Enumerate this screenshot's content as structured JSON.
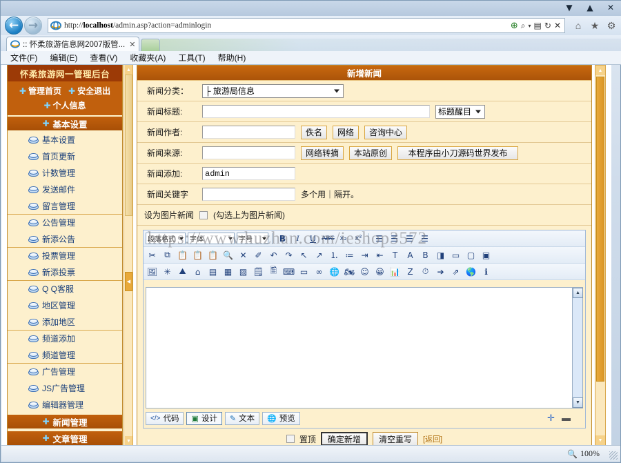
{
  "window": {
    "controls": {
      "minimize": "▼",
      "maximize": "▲",
      "close": "✕"
    }
  },
  "browser": {
    "back_icon": "←",
    "forward_icon": "→",
    "url_prefix": "http://",
    "url_host": "localhost",
    "url_rest": "/admin.asp?action=adminlogin",
    "address_icons": {
      "compatibility": "⊕",
      "search": "⌕",
      "search_caret": "▾",
      "feed": "▤",
      "refresh": "↻",
      "stop": "✕"
    },
    "toolbar_icons": {
      "home": "⌂",
      "favorites": "★",
      "tools": "⚙"
    },
    "tab": {
      "title": ":: 怀柔旅游信息网2007版管...",
      "close": "✕"
    },
    "menu": [
      {
        "label": "文件(F)",
        "key": "F"
      },
      {
        "label": "编辑(E)",
        "key": "E"
      },
      {
        "label": "查看(V)",
        "key": "V"
      },
      {
        "label": "收藏夹(A)",
        "key": "A"
      },
      {
        "label": "工具(T)",
        "key": "T"
      },
      {
        "label": "帮助(H)",
        "key": "H"
      }
    ],
    "status": {
      "zoom": "100%",
      "mag_icon": "🔍"
    }
  },
  "sidebar": {
    "title": "怀柔旅游网一管理后台",
    "top_links": [
      {
        "label": "管理首页"
      },
      {
        "label": "安全退出"
      },
      {
        "label": "个人信息"
      }
    ],
    "group_basic": "基本设置",
    "items": [
      {
        "label": "基本设置",
        "sep": false
      },
      {
        "label": "首页更新",
        "sep": false
      },
      {
        "label": "计数管理",
        "sep": false
      },
      {
        "label": "发送邮件",
        "sep": false
      },
      {
        "label": "留言管理",
        "sep": false
      },
      {
        "label": "公告管理",
        "sep": true
      },
      {
        "label": "新添公告",
        "sep": false
      },
      {
        "label": "投票管理",
        "sep": true
      },
      {
        "label": "新添投票",
        "sep": false
      },
      {
        "label": "Q Q客服",
        "sep": true
      },
      {
        "label": "地区管理",
        "sep": false
      },
      {
        "label": "添加地区",
        "sep": false
      },
      {
        "label": "频道添加",
        "sep": true
      },
      {
        "label": "频道管理",
        "sep": false
      },
      {
        "label": "广告管理",
        "sep": true
      },
      {
        "label": "JS广告管理",
        "sep": false
      },
      {
        "label": "编辑器管理",
        "sep": false
      }
    ],
    "group_news": "新闻管理",
    "group_article": "文章管理"
  },
  "main": {
    "title": "新增新闻",
    "rows": {
      "category": {
        "label": "新闻分类：",
        "value": "├ 旅游局信息"
      },
      "title": {
        "label": "新闻标题:",
        "value": "",
        "highlight_select": "标题醒目"
      },
      "author": {
        "label": "新闻作者:",
        "value": "",
        "buttons": [
          "佚名",
          "网络",
          "咨询中心"
        ]
      },
      "source": {
        "label": "新闻来源:",
        "value": "",
        "buttons": [
          "网络转摘",
          "本站原创",
          "本程序由小刀源码世界发布"
        ]
      },
      "addedby": {
        "label": "新闻添加:",
        "value": "admin"
      },
      "keywords": {
        "label": "新闻关键字",
        "value": "",
        "hint": "多个用｜隔开。"
      },
      "photonews": {
        "label": "设为图片新闻",
        "hint": "(勾选上为图片新闻)",
        "checked": false
      }
    },
    "submit": {
      "checkbox_label": "置顶",
      "confirm": "确定新增",
      "reset": "清空重写",
      "back": "[返回]"
    }
  },
  "editor": {
    "row1": {
      "style_select": "段落格式",
      "font_select": "字体",
      "size_select": "字号",
      "icons": [
        "bold-icon",
        "italic-icon",
        "underline-icon",
        "strikethrough-icon",
        "subscript-icon",
        "superscript-icon",
        "align-left-icon",
        "align-center-icon",
        "align-right-icon",
        "align-justify-icon"
      ],
      "glyphs": [
        "B",
        "I",
        "U",
        "ABC",
        "x₂",
        "x²",
        "≡",
        "≡",
        "≡",
        "≡"
      ]
    },
    "row2_glyphs": [
      "✂",
      "⧉",
      "📋",
      "📋",
      "📋",
      "🔍",
      "✕",
      "✐",
      "↶",
      "↷",
      "↖",
      "↗",
      "⒈",
      "≔",
      "⇥",
      "⇤",
      "T",
      "A",
      "B",
      "◨",
      "▭",
      "▢",
      "▣"
    ],
    "row3_glyphs": [
      "🖼",
      "✳",
      "⛰",
      "⌂",
      "▤",
      "▦",
      "▨",
      "🗒",
      "🖺",
      "⌨",
      "▭",
      "∞",
      "🌐",
      "🏍",
      "☺",
      "😀",
      "📊",
      "Z",
      "⏱",
      "➔",
      "⇗",
      "🌎",
      "ℹ"
    ],
    "tabs": [
      {
        "label": "代码",
        "icon": "code-icon",
        "active": false
      },
      {
        "label": "设计",
        "icon": "design-icon",
        "active": true
      },
      {
        "label": "文本",
        "icon": "text-icon",
        "active": false
      },
      {
        "label": "预览",
        "icon": "preview-icon",
        "active": false
      }
    ],
    "resize": {
      "expand": "✛",
      "collapse": "▬"
    },
    "content": ""
  },
  "watermark": {
    "text": "https://www.huzhan.com/ieshop3572"
  }
}
